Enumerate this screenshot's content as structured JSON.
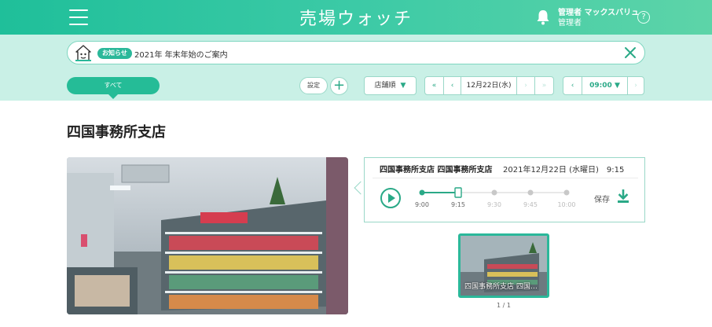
{
  "header": {
    "brand": "売場ウォッチ",
    "user_name": "管理者 マックスバリュ",
    "user_role": "管理者",
    "help_label": "?"
  },
  "notice": {
    "badge": "お知らせ",
    "text": "2021年 年末年始のご案内"
  },
  "filters": {
    "all_label": "すべて",
    "settings_label": "設定",
    "add_label": "+",
    "sort_label": "店舗順"
  },
  "date_nav": {
    "date": "12月22日(水)"
  },
  "time_nav": {
    "time": "09:00"
  },
  "store": {
    "title": "四国事務所支店"
  },
  "playback": {
    "title": "四国事務所支店 四国事務所支店",
    "datetime": "2021年12月22日 (水曜日)　9:15",
    "save_label": "保存",
    "ticks": [
      "9:00",
      "9:15",
      "9:30",
      "9:45",
      "10:00"
    ],
    "active_count": 2,
    "selected_index": 1
  },
  "thumbnails": {
    "items": [
      {
        "label": "四国事務所支店 四国…"
      }
    ],
    "pager": "1 / 1"
  },
  "colors": {
    "accent": "#2aa987",
    "header": "#3ccaa6",
    "toolbar_bg": "#c9f0e6"
  }
}
